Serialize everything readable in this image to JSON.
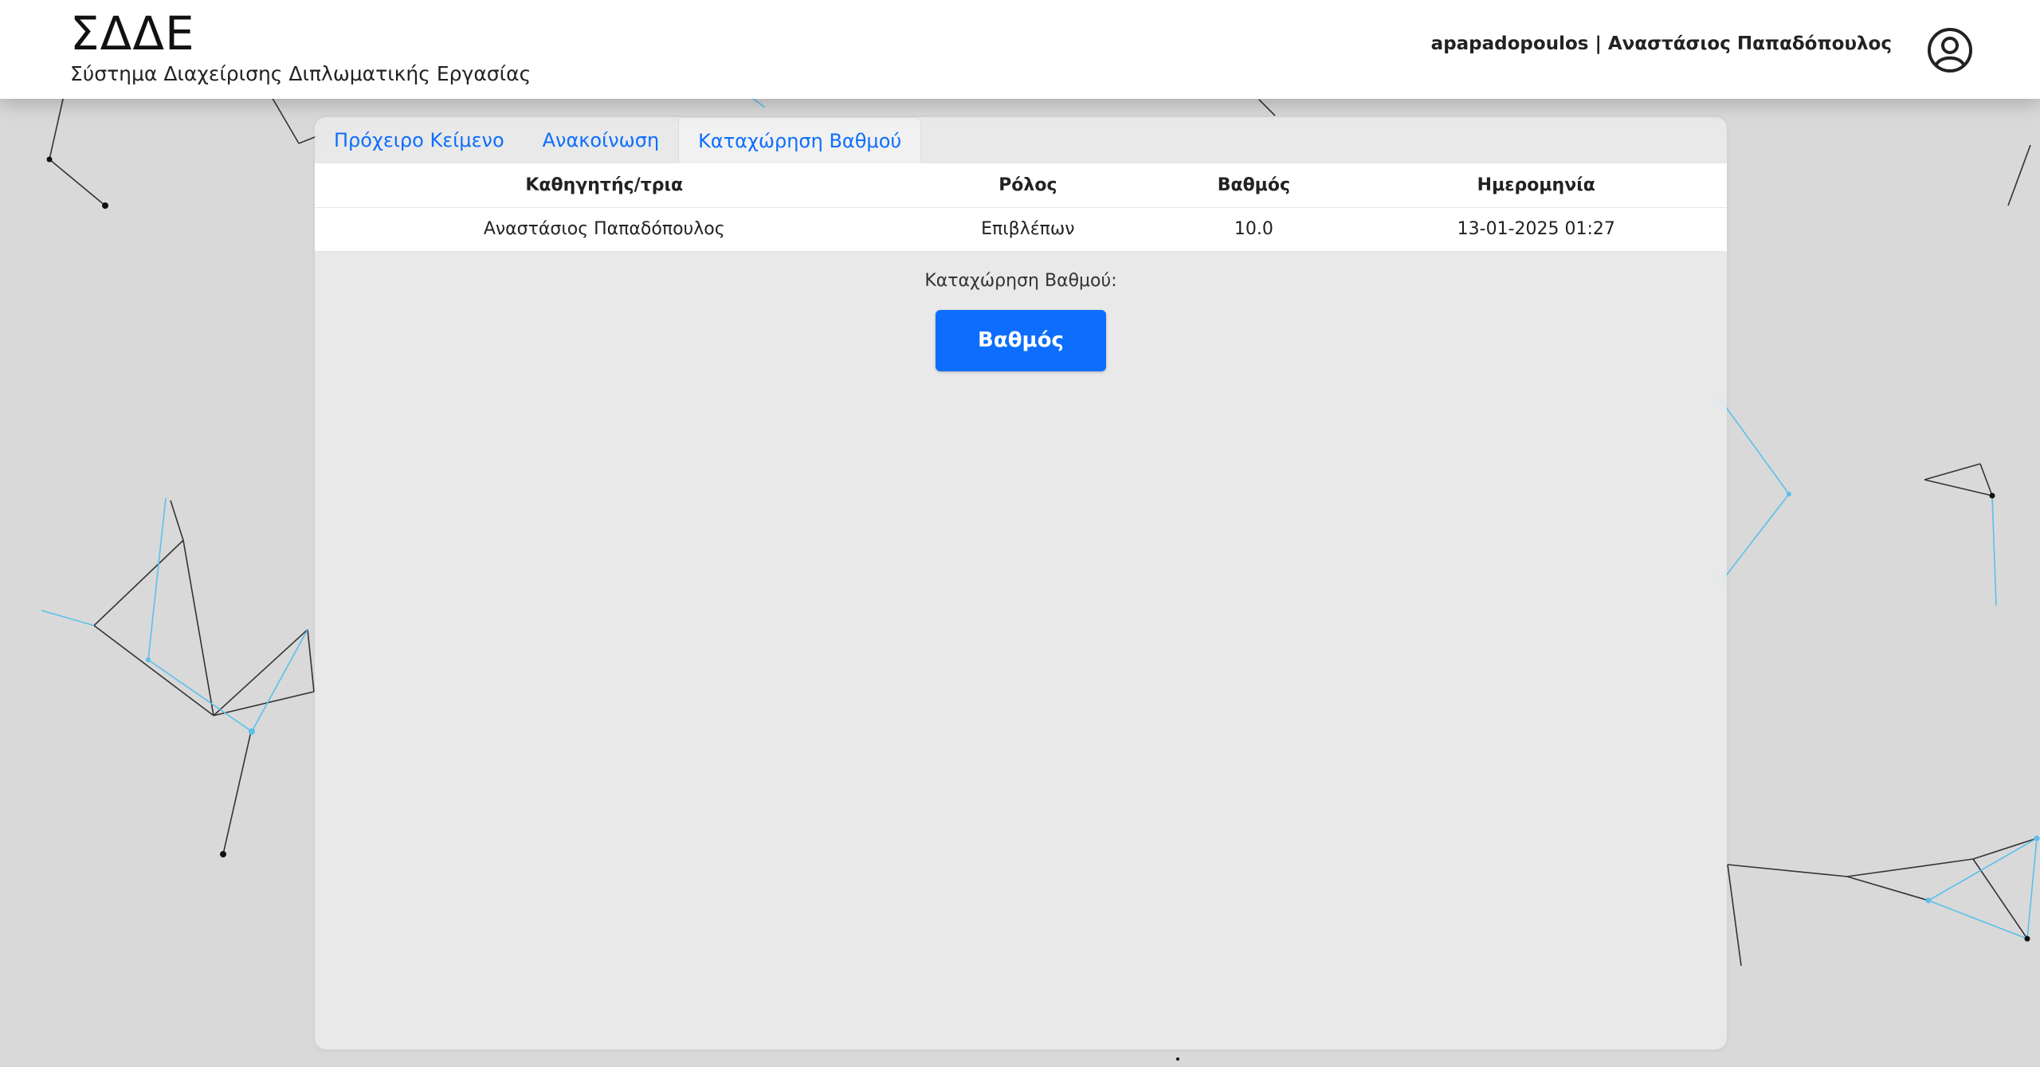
{
  "header": {
    "title": "ΣΔΔΕ",
    "subtitle": "Σύστημα Διαχείρισης Διπλωματικής Εργασίας",
    "user": "apapadopoulos | Αναστάσιος Παπαδόπουλος",
    "user_icon": "user-circle-icon"
  },
  "tabs": [
    {
      "label": "Πρόχειρο Κείμενο"
    },
    {
      "label": "Ανακοίνωση"
    },
    {
      "label": "Καταχώρηση Βαθμού",
      "active": true
    }
  ],
  "grades_table": {
    "headers": [
      "Καθηγητής/τρια",
      "Ρόλος",
      "Βαθμός",
      "Ημερομηνία"
    ],
    "rows": [
      [
        "Αναστάσιος Παπαδόπουλος",
        "Επιβλέπων",
        "10.0",
        "13-01-2025 01:27"
      ]
    ]
  },
  "grade_entry": {
    "label": "Καταχώρηση Βαθμού:",
    "button": "Βαθμός"
  },
  "colors": {
    "accent": "#0d6efd",
    "background": "#d9d9d9",
    "network_line_dark": "#333333",
    "network_line_blue": "#5bc0eb"
  }
}
